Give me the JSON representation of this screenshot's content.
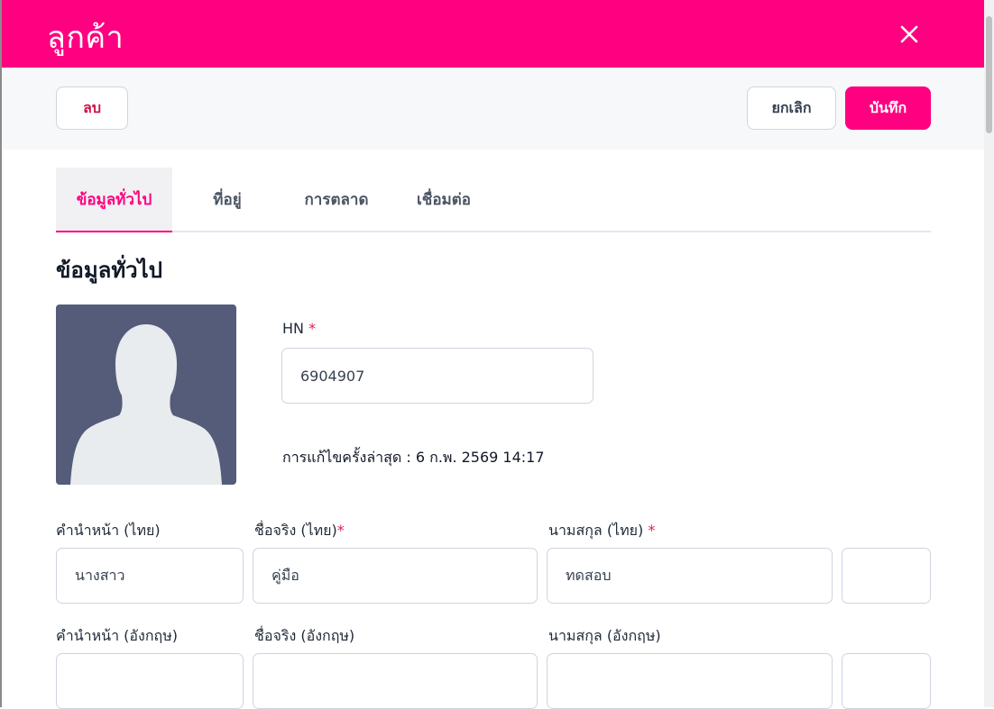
{
  "header": {
    "title": "ลูกค้า"
  },
  "toolbar": {
    "delete_label": "ลบ",
    "cancel_label": "ยกเลิก",
    "save_label": "บันทึก"
  },
  "tabs": [
    {
      "label": "ข้อมูลทั่วไป",
      "active": true
    },
    {
      "label": "ที่อยู่",
      "active": false
    },
    {
      "label": "การตลาด",
      "active": false
    },
    {
      "label": "เชื่อมต่อ",
      "active": false
    }
  ],
  "section": {
    "title": "ข้อมูลทั่วไป"
  },
  "hn": {
    "label": "HN",
    "required_mark": "*",
    "value": "6904907"
  },
  "last_updated": {
    "text": "การแก้ไขครั้งล่าสุด : 6 ก.พ. 2569 14:17"
  },
  "form": {
    "prefix_th": {
      "label": "คำนำหน้า (ไทย)",
      "value": "นางสาว"
    },
    "firstname_th": {
      "label": "ชื่อจริง (ไทย)",
      "required_mark": "*",
      "value": "คู่มือ"
    },
    "lastname_th": {
      "label": "นามสกุล (ไทย)",
      "required_mark": "*",
      "value": "ทดสอบ"
    },
    "extra_th": {
      "value": ""
    },
    "prefix_en": {
      "label": "คำนำหน้า (อังกฤษ)",
      "value": ""
    },
    "firstname_en": {
      "label": "ชื่อจริง (อังกฤษ)",
      "value": ""
    },
    "lastname_en": {
      "label": "นามสกุล (อังกฤษ)",
      "value": ""
    },
    "extra_en": {
      "value": ""
    }
  },
  "colors": {
    "brand": "#ff0080",
    "danger": "#d0114b",
    "avatar_bg": "#545c7a"
  },
  "icons": {
    "close": "close-icon",
    "avatar": "user-silhouette-icon"
  }
}
